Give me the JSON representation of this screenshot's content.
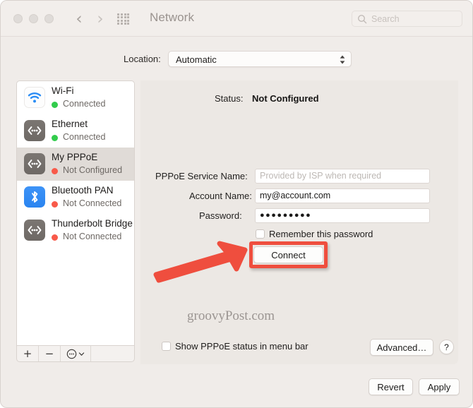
{
  "window": {
    "title": "Network",
    "traffic_lights": [
      "close",
      "minimize",
      "zoom"
    ],
    "nav_back": "‹",
    "nav_forward": "›",
    "grid_icon": "grid-icon"
  },
  "search": {
    "placeholder": "Search",
    "icon": "search-icon"
  },
  "location": {
    "label": "Location:",
    "value": "Automatic",
    "options": [
      "Automatic"
    ]
  },
  "sidebar": {
    "services": [
      {
        "name": "Wi-Fi",
        "status": "Connected",
        "status_color": "#32cc4c",
        "icon": "wifi-icon",
        "selected": false
      },
      {
        "name": "Ethernet",
        "status": "Connected",
        "status_color": "#32cc4c",
        "icon": "ethernet-icon",
        "selected": false
      },
      {
        "name": "My PPPoE",
        "status": "Not Configured",
        "status_color": "#f85a4a",
        "icon": "ethernet-icon",
        "selected": true
      },
      {
        "name": "Bluetooth PAN",
        "status": "Not Connected",
        "status_color": "#f85a4a",
        "icon": "bluetooth-icon",
        "selected": false
      },
      {
        "name": "Thunderbolt Bridge",
        "status": "Not Connected",
        "status_color": "#f85a4a",
        "icon": "ethernet-icon",
        "selected": false
      }
    ],
    "toolbar": {
      "add": "+",
      "remove": "−",
      "action": "⚙"
    }
  },
  "main": {
    "status_label": "Status:",
    "status_value": "Not Configured",
    "service_name_label": "PPPoE Service Name:",
    "service_name_value": "",
    "service_name_placeholder": "Provided by ISP when required",
    "account_name_label": "Account Name:",
    "account_name_value": "my@account.com",
    "password_label": "Password:",
    "password_value": "●●●●●●●●●",
    "remember_password_label": "Remember this password",
    "remember_password_checked": false,
    "connect_button": "Connect",
    "show_status_label": "Show PPPoE status in menu bar",
    "show_status_checked": false,
    "advanced_button": "Advanced…",
    "help_button": "?"
  },
  "annotation": {
    "highlight_color": "#ef4e3e",
    "target": "Connect"
  },
  "watermark": "groovyPost.com",
  "footer": {
    "revert_button": "Revert",
    "apply_button": "Apply"
  }
}
